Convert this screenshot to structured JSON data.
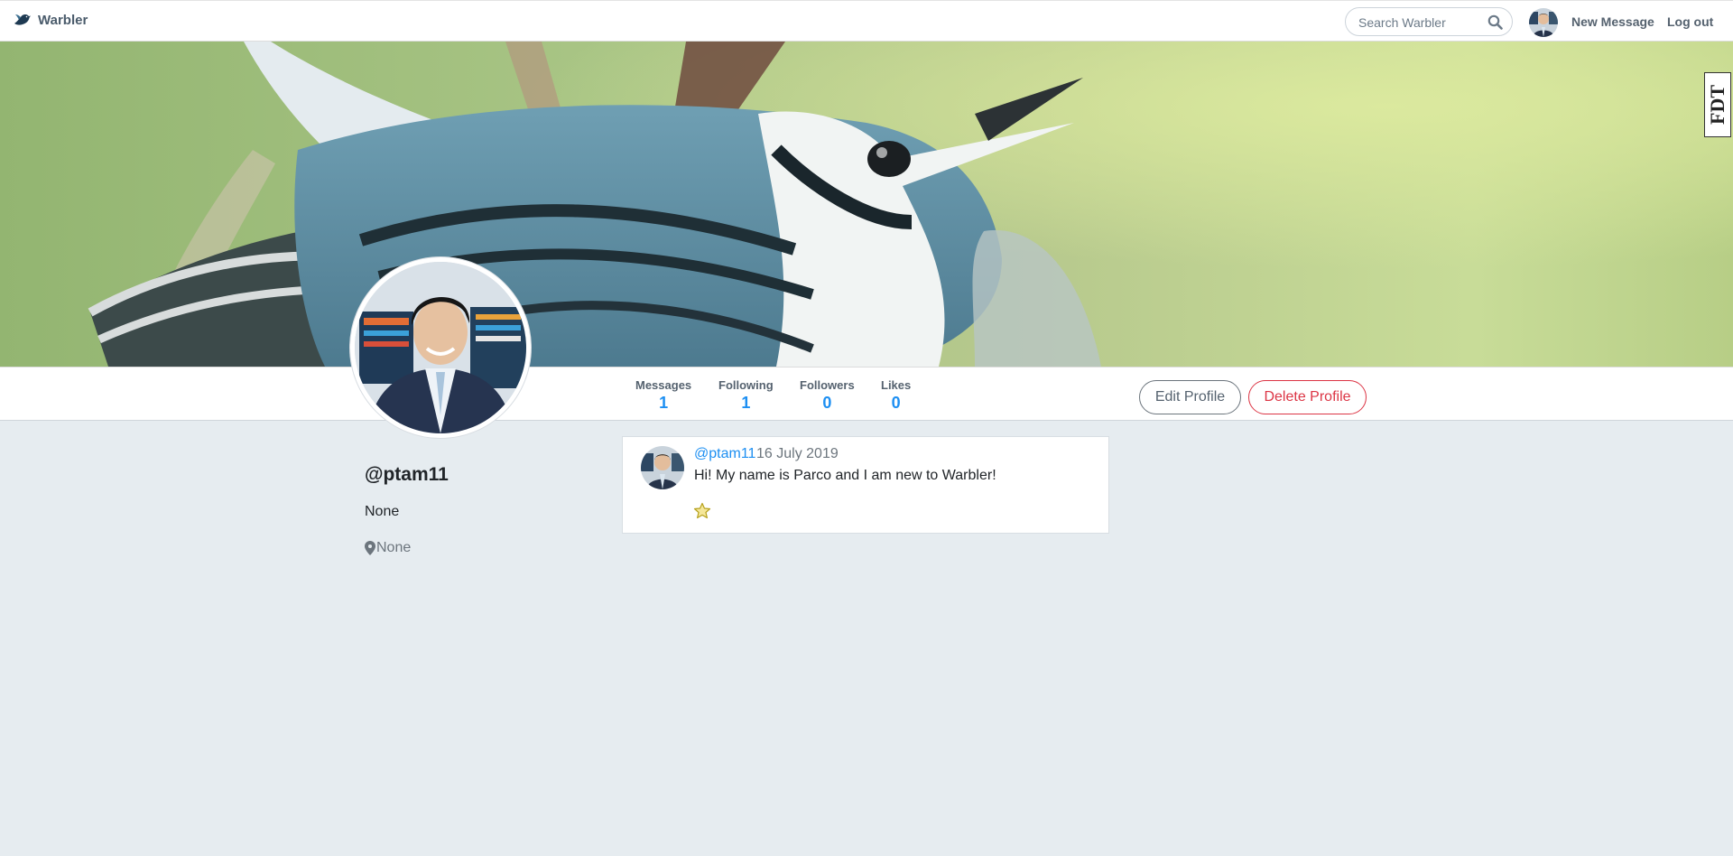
{
  "nav": {
    "brand": "Warbler",
    "search_placeholder": "Search Warbler",
    "new_message": "New Message",
    "logout": "Log out"
  },
  "extension_badge": "FDT",
  "stats": {
    "messages": {
      "label": "Messages",
      "value": "1"
    },
    "following": {
      "label": "Following",
      "value": "1"
    },
    "followers": {
      "label": "Followers",
      "value": "0"
    },
    "likes": {
      "label": "Likes",
      "value": "0"
    }
  },
  "actions": {
    "edit_profile": "Edit Profile",
    "delete_profile": "Delete Profile"
  },
  "profile": {
    "username": "@ptam11",
    "bio": "None",
    "location": "None"
  },
  "messages": [
    {
      "user": "@ptam11",
      "date": "16 July 2019",
      "text": "Hi! My name is Parco and I am new to Warbler!"
    }
  ],
  "icons": {
    "brand": "bird-icon",
    "search": "search-icon",
    "location": "map-pin-icon",
    "like": "star-icon"
  },
  "colors": {
    "accent": "#1d8ff2",
    "danger": "#dc3545",
    "page_bg": "#e6ecf0",
    "nav_text": "#55626f"
  }
}
